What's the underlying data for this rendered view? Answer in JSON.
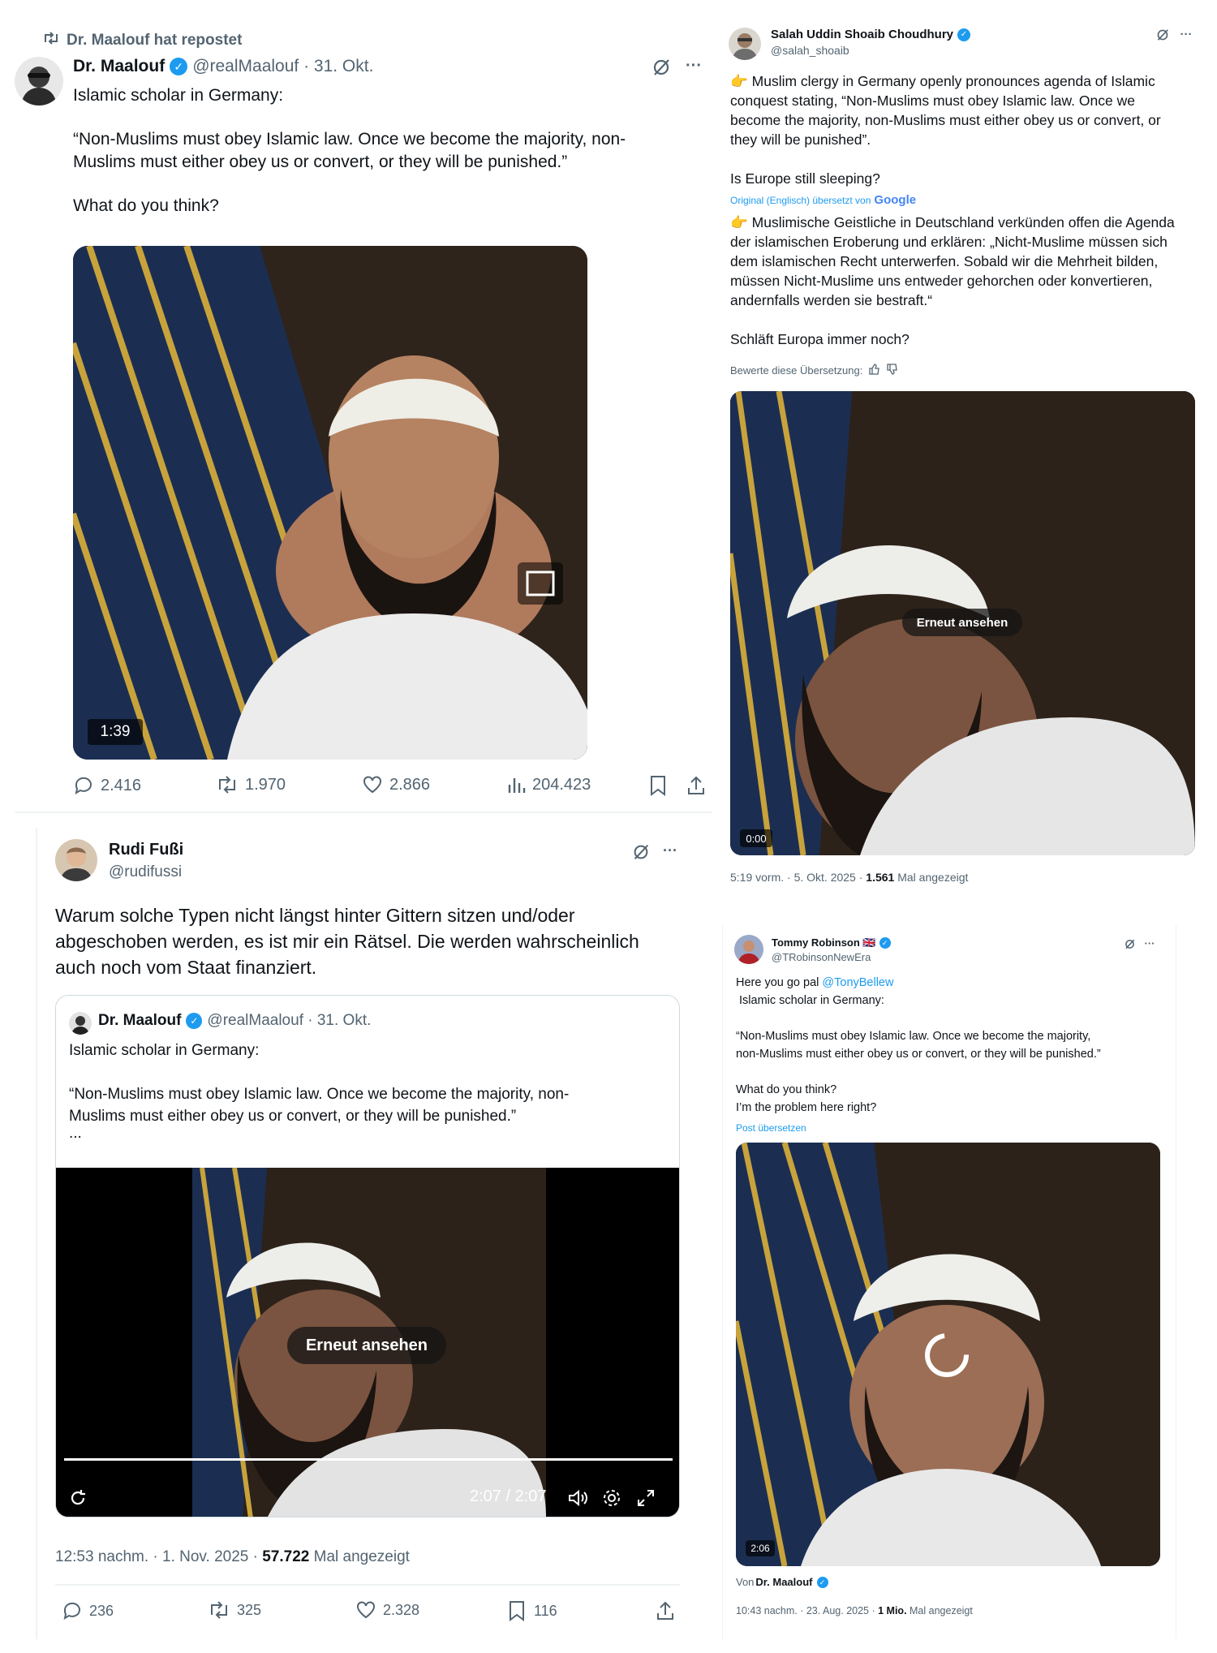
{
  "post1": {
    "repost_label": "Dr. Maalouf  hat repostet",
    "author": "Dr. Maalouf",
    "handle_time": "@realMaalouf · 31. Okt.",
    "lines": [
      "Islamic scholar in Germany:",
      "",
      "“Non-Muslims must obey Islamic law. Once we become the majority, non-",
      "Muslims must either obey us or convert, or they will be punished.”",
      "",
      "What do you think?"
    ],
    "video_duration": "1:39",
    "replies": "2.416",
    "reposts": "1.970",
    "likes": "2.866",
    "views": "204.423"
  },
  "post2": {
    "author": "Salah Uddin Shoaib Choudhury",
    "handle": "@salah_shoaib",
    "lines": [
      "👉 Muslim clergy in Germany openly pronounces agenda of Islamic",
      "conquest stating, “Non-Muslims must obey Islamic law. Once we",
      "become the majority, non-Muslims must either obey us or convert, or",
      "they will be punished”.",
      "",
      "Is Europe still sleeping?"
    ],
    "translation_note": "Original (Englisch) übersetzt von",
    "translation_brand": "Google",
    "translated_lines": [
      "👉 Muslimische Geistliche in Deutschland verkünden offen die Agenda",
      "der islamischen Eroberung und erklären: „Nicht-Muslime müssen sich",
      "dem islamischen Recht unterwerfen. Sobald wir die Mehrheit bilden,",
      "müssen Nicht-Muslime uns entweder gehorchen oder konvertieren,",
      "andernfalls werden sie bestraft.“",
      "",
      "Schläft Europa immer noch?"
    ],
    "rate_label": "Bewerte diese Übersetzung:",
    "replay_label": "Erneut ansehen",
    "video_time": "0:00",
    "meta_time": "5:19 vorm. · 5. Okt. 2025 · ",
    "meta_views": "1.561",
    "meta_views_label": " Mal angezeigt"
  },
  "post3": {
    "author": "Rudi Fußi",
    "handle": "@rudifussi",
    "lines": [
      "Warum solche Typen nicht längst hinter Gittern sitzen und/oder",
      "abgeschoben werden, es ist mir ein Rätsel. Die werden wahrscheinlich",
      "auch noch vom Staat finanziert."
    ],
    "quote_author": "Dr. Maalouf",
    "quote_handle_time": "@realMaalouf · 31. Okt.",
    "quote_lines": [
      "Islamic scholar in Germany:",
      "",
      "“Non-Muslims must obey Islamic law. Once we become the majority, non-",
      "Muslims must either obey us or convert, or they will be punished.”",
      "..."
    ],
    "replay_label": "Erneut ansehen",
    "video_time": "2:07 / 2:07",
    "meta_time": "12:53 nachm. · 1. Nov. 2025 · ",
    "meta_views": "57.722",
    "meta_views_label": " Mal angezeigt",
    "replies": "236",
    "reposts": "325",
    "likes": "2.328",
    "bookmarks": "116"
  },
  "post4": {
    "author": "Tommy Robinson 🇬🇧",
    "handle": "@TRobinsonNewEra",
    "reply_prefix": "Here you go pal ",
    "reply_mention": "@TonyBellew",
    "lines": [
      " Islamic scholar in Germany:",
      "",
      "“Non-Muslims must obey Islamic law. Once we become the majority,",
      "non-Muslims must either obey us or convert, or they will be punished.”",
      "",
      "What do you think?",
      "I’m the problem here right?"
    ],
    "translate_link": "Post übersetzen",
    "video_duration": "2:06",
    "from_label": "Von ",
    "from_author": "Dr. Maalouf",
    "meta_time": "10:43 nachm. · 23. Aug. 2025 · ",
    "meta_views": "1 Mio.",
    "meta_views_label": " Mal angezeigt"
  },
  "icons": {
    "more": "···",
    "grok": "grok-icon",
    "verified": "✓"
  },
  "colors": {
    "accent": "#1d9bf0",
    "text": "#0f1419",
    "muted": "#536471"
  }
}
